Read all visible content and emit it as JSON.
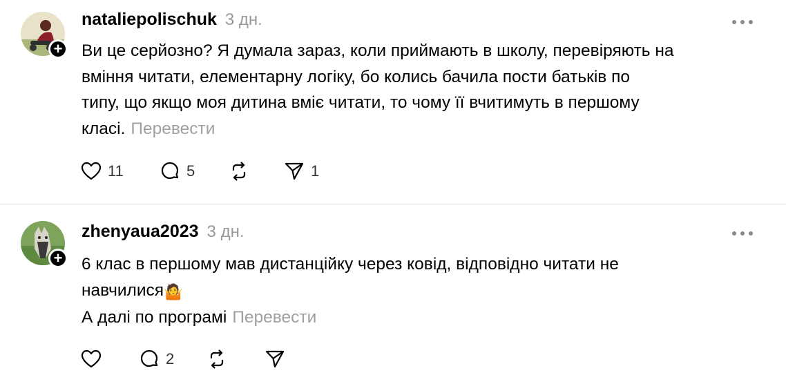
{
  "posts": [
    {
      "username": "nataliepolischuk",
      "time": "3 дн.",
      "lines": [
        "Ви це серйозно? Я думала зараз, коли приймають в школу, перевіряють на",
        "вміння читати, елементарну логіку, бо колись бачила пости батьків по",
        "типу, що якщо моя дитина вміє читати, то чому її вчитимуть в першому",
        "класі."
      ],
      "translate": "Перевести",
      "likes": "11",
      "replies": "5",
      "reposts": "",
      "shares": "1",
      "icons": {
        "like": "heart-icon",
        "reply": "comment-icon",
        "repost": "repost-icon",
        "share": "send-icon",
        "more": "more-icon",
        "follow": "plus-icon"
      }
    },
    {
      "username": "zhenyaua2023",
      "time": "3 дн.",
      "lines": [
        "6 клас в першому мав дистанційку через ковід, відповідно читати не",
        "навчилися",
        "А далі по програмі"
      ],
      "emoji": "🤷",
      "translate": "Перевести",
      "likes": "",
      "replies": "2",
      "reposts": "",
      "shares": "",
      "icons": {
        "like": "heart-icon",
        "reply": "comment-icon",
        "repost": "repost-icon",
        "share": "send-icon",
        "more": "more-icon",
        "follow": "plus-icon"
      }
    }
  ],
  "colors": {
    "text": "#000000",
    "muted": "#999999",
    "translate": "#a0a0a0",
    "divider": "#dcdcdc"
  }
}
